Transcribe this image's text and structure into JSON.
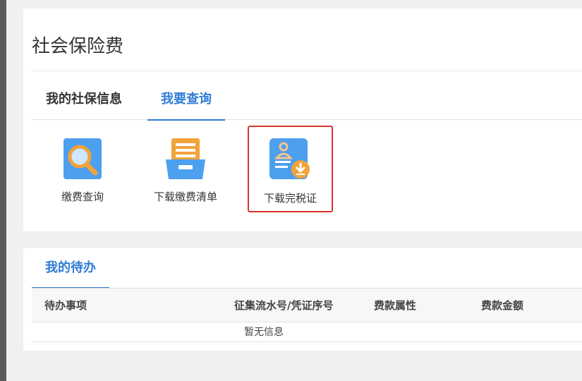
{
  "page": {
    "title": "社会保险费",
    "tabs": [
      {
        "label": "我的社保信息"
      },
      {
        "label": "我要查询"
      }
    ],
    "active_tab": "我要查询",
    "accent_color": "#2f7cd6",
    "highlight_color": "#d9342b"
  },
  "shortcuts": [
    {
      "label": "缴费查询",
      "icon": "search-icon"
    },
    {
      "label": "下载缴费清单",
      "icon": "tray-list-icon"
    },
    {
      "label": "下载完税证",
      "icon": "certificate-download-icon"
    }
  ],
  "todo": {
    "tab_label": "我的待办",
    "columns": [
      "待办事项",
      "征集流水号/凭证序号",
      "费款属性",
      "费款金额"
    ],
    "empty_text": "暂无信息"
  }
}
